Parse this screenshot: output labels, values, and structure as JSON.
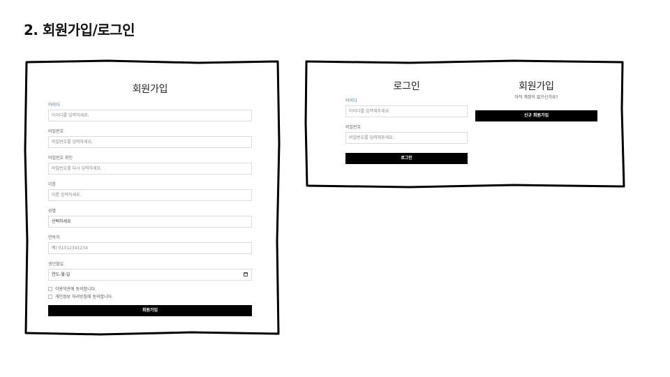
{
  "slide_title": "2. 회원가입/로그인",
  "signup": {
    "title": "회원가입",
    "fields": [
      {
        "label": "아이디",
        "placeholder": "아이디를 입력하세요."
      },
      {
        "label": "비밀번호",
        "placeholder": "비밀번호를 입력하세요."
      },
      {
        "label": "비밀번호 확인",
        "placeholder": "비밀번호를 다시 입력하세요."
      },
      {
        "label": "이름",
        "placeholder": "이름 입력하세요."
      },
      {
        "label": "성별",
        "value": "선택하세요"
      },
      {
        "label": "연락처",
        "placeholder": "예) 01012341234"
      },
      {
        "label": "생년월일",
        "placeholder": "연도-월-일"
      }
    ],
    "agree_terms": "이용약관에 동의합니다.",
    "agree_privacy": "개인정보 처리방침에 동의합니다.",
    "submit_label": "회원가입"
  },
  "login": {
    "title": "로그인",
    "id_label": "아이디",
    "id_placeholder": "아이디를 입력해주세요.",
    "pw_label": "비밀번호",
    "pw_placeholder": "비밀번호를 입력해주세요.",
    "submit_label": "로그인"
  },
  "register_prompt": {
    "title": "회원가입",
    "subtitle": "아직 계정이 없으신가요?",
    "button_label": "신규 회원가입"
  }
}
